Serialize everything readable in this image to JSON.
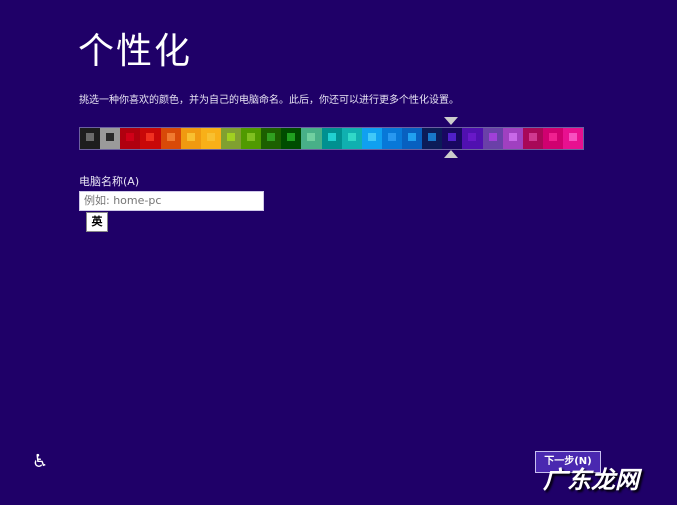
{
  "title": "个性化",
  "description": "挑选一种你喜欢的颜色，并为自己的电脑命名。此后，你还可以进行更多个性化设置。",
  "palette": {
    "selected_index": 18,
    "swatches": [
      [
        "#1d1d1d",
        "#6a6a6a"
      ],
      [
        "#9a9a9a",
        "#2a2a2a"
      ],
      [
        "#b0000f",
        "#d00018"
      ],
      [
        "#c80808",
        "#f03020"
      ],
      [
        "#d84a08",
        "#f07a30"
      ],
      [
        "#f09a10",
        "#f8c030"
      ],
      [
        "#f8b018",
        "#f8c030"
      ],
      [
        "#80a030",
        "#a0d020"
      ],
      [
        "#509a00",
        "#80c020"
      ],
      [
        "#1c6000",
        "#30a020"
      ],
      [
        "#004c00",
        "#20a020"
      ],
      [
        "#48b088",
        "#70d0a0"
      ],
      [
        "#009090",
        "#20d0d0"
      ],
      [
        "#10b0b0",
        "#30d8c8"
      ],
      [
        "#10a0f0",
        "#40c8f8"
      ],
      [
        "#0878d8",
        "#2898f0"
      ],
      [
        "#0860c0",
        "#20a0f0"
      ],
      [
        "#0c1c58",
        "#1878c8"
      ],
      [
        "#180860",
        "#5020c8"
      ],
      [
        "#5010b0",
        "#6818c8"
      ],
      [
        "#6a40a8",
        "#a040d8"
      ],
      [
        "#a040c0",
        "#c868e8"
      ],
      [
        "#a80858",
        "#d03890"
      ],
      [
        "#d00070",
        "#f02090"
      ],
      [
        "#e81090",
        "#f850c0"
      ]
    ]
  },
  "computer_name": {
    "label": "电脑名称(A)",
    "placeholder": "例如: home-pc",
    "ime_indicator": "英"
  },
  "next_button": "下一步(N)",
  "watermark": "广东龙网"
}
